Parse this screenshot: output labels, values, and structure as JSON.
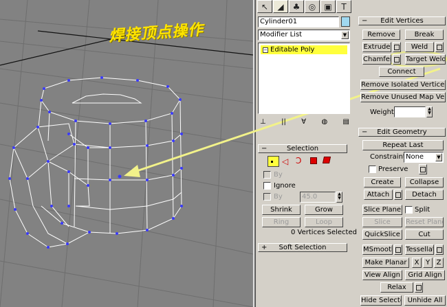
{
  "annotation": {
    "text": "焊接顶点操作"
  },
  "tabs": [
    {
      "name": "create-tab-icon",
      "glyph": "↖"
    },
    {
      "name": "modify-tab-icon",
      "glyph": "◢"
    },
    {
      "name": "hierarchy-tab-icon",
      "glyph": "♣"
    },
    {
      "name": "motion-tab-icon",
      "glyph": "◎"
    },
    {
      "name": "display-tab-icon",
      "glyph": "▣"
    },
    {
      "name": "utilities-tab-icon",
      "glyph": "T"
    }
  ],
  "object": {
    "name": "Cylinder01",
    "color": "#a0d8f0"
  },
  "modifier_list": {
    "label": "Modifier List"
  },
  "stack": {
    "item": "Editable Poly",
    "highlight": "#ffff3c"
  },
  "stack_toolbar": [
    "⊥",
    "||",
    "∀",
    "◍",
    "▤"
  ],
  "selection": {
    "title": "Selection",
    "by_vertex_label": "By",
    "ignore_label": "Ignore",
    "by_angle_label": "By",
    "angle_value": "45.0",
    "shrink_label": "Shrink",
    "grow_label": "Grow",
    "ring_label": "Ring",
    "loop_label": "Loop",
    "status": "0 Vertices Selected"
  },
  "soft_selection": {
    "title": "Soft Selection"
  },
  "edit_vertices": {
    "title": "Edit Vertices",
    "remove_label": "Remove",
    "break_label": "Break",
    "extrude_label": "Extrude",
    "weld_label": "Weld",
    "chamfer_label": "Chamfer",
    "target_weld_label": "Target Weld",
    "connect_label": "Connect",
    "remove_isolated_label": "Remove Isolated Vertices",
    "remove_unused_label": "Remove Unused Map Verts",
    "weight_label": "Weight"
  },
  "edit_geometry": {
    "title": "Edit Geometry",
    "repeat_last_label": "Repeat Last",
    "constraints_label": "Constraints",
    "constraints_value": "None",
    "preserve_label": "Preserve",
    "create_label": "Create",
    "collapse_label": "Collapse",
    "attach_label": "Attach",
    "detach_label": "Detach",
    "slice_plane_label": "Slice Plane",
    "split_label": "Split",
    "slice_label": "Slice",
    "reset_plane_label": "Reset Plane",
    "quickslice_label": "QuickSlice",
    "cut_label": "Cut",
    "msmooth_label": "MSmooth",
    "tessellate_label": "Tessellate",
    "make_planar_label": "Make Planar",
    "x_label": "X",
    "y_label": "Y",
    "z_label": "Z",
    "view_align_label": "View Align",
    "grid_align_label": "Grid Align",
    "relax_label": "Relax",
    "hide_selected_label": "Hide Selected",
    "unhide_all_label": "Unhide All"
  },
  "colors": {
    "viewport": "#828282",
    "wire": "#ffffff",
    "vertex": "#3a3aff",
    "arrow": "#f2f28a",
    "highlight_ring": "#e8e890"
  }
}
